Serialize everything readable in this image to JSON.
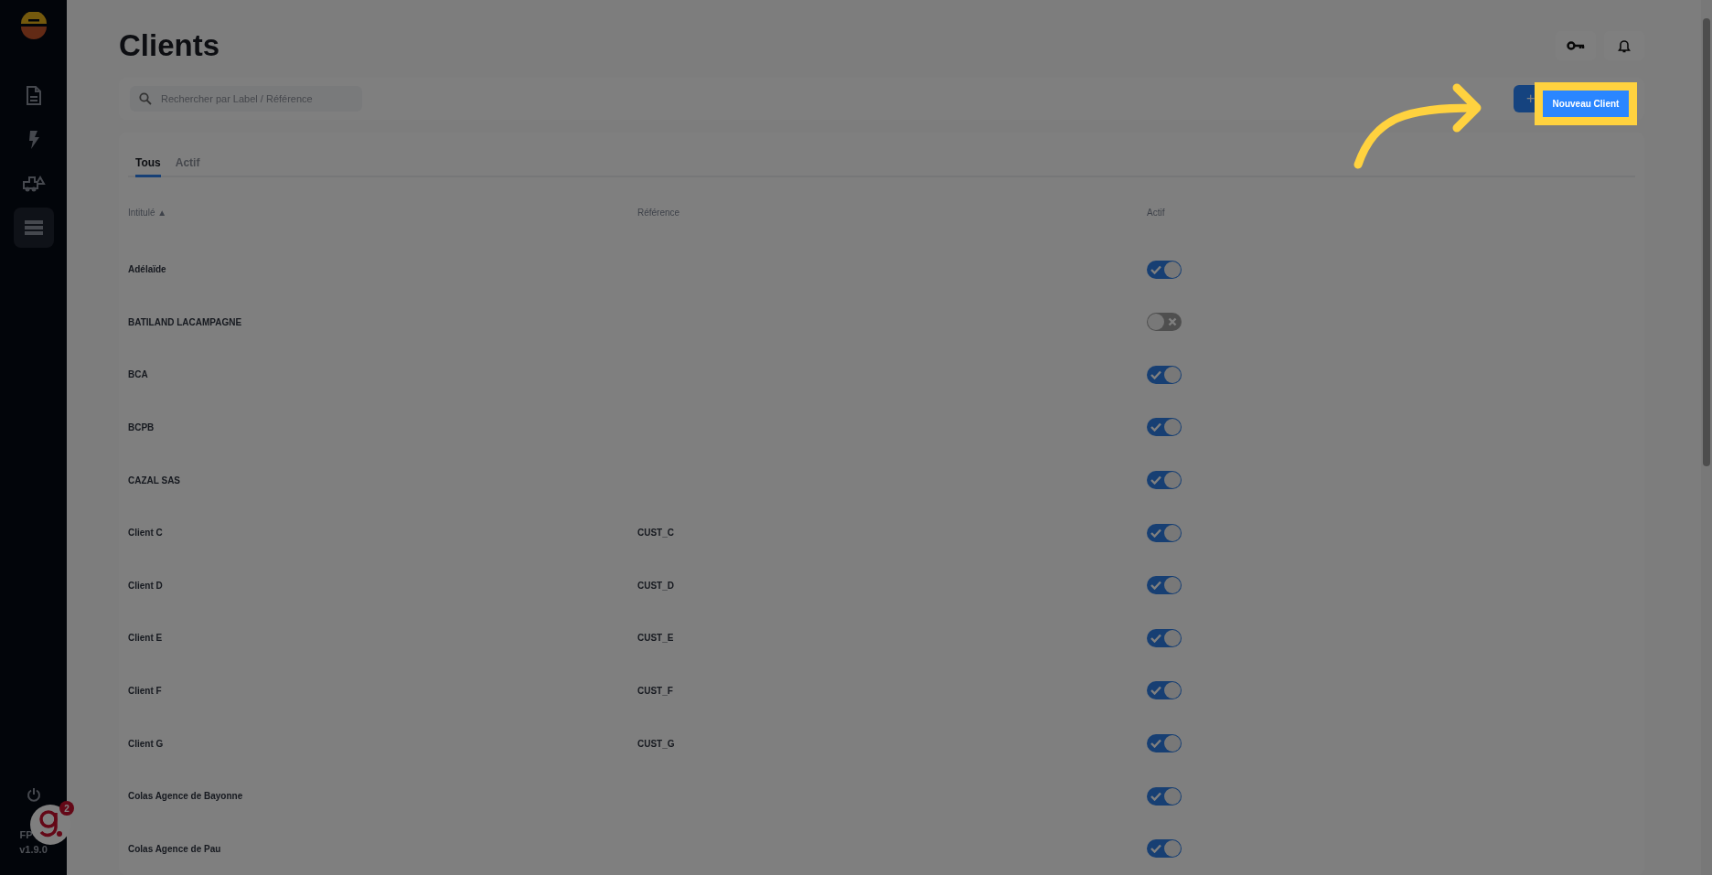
{
  "sidebar": {
    "items": [
      {
        "kind": "document",
        "selected": false
      },
      {
        "kind": "bolt",
        "selected": false
      },
      {
        "kind": "truck",
        "selected": false
      },
      {
        "kind": "list",
        "selected": true
      }
    ],
    "footer_label": "FP",
    "version": "v1.9.0",
    "badge_count": "2"
  },
  "page": {
    "title": "Clients"
  },
  "search": {
    "placeholder": "Rechercher par Label / Référence"
  },
  "new_button": {
    "icon_text": "+",
    "label": "Nouveau Client"
  },
  "tabs": [
    {
      "label": "Tous",
      "selected": true
    },
    {
      "label": "Actif",
      "selected": false
    }
  ],
  "table": {
    "columns": [
      "Intitulé ▲",
      "Référence",
      "Actif"
    ],
    "rows": [
      {
        "name": "Adélaïde",
        "reference": "",
        "active": true
      },
      {
        "name": "BATILAND LACAMPAGNE",
        "reference": "",
        "active": false
      },
      {
        "name": "BCA",
        "reference": "",
        "active": true
      },
      {
        "name": "BCPB",
        "reference": "",
        "active": true
      },
      {
        "name": "CAZAL SAS",
        "reference": "",
        "active": true
      },
      {
        "name": "Client C",
        "reference": "CUST_C",
        "active": true
      },
      {
        "name": "Client D",
        "reference": "CUST_D",
        "active": true
      },
      {
        "name": "Client E",
        "reference": "CUST_E",
        "active": true
      },
      {
        "name": "Client F",
        "reference": "CUST_F",
        "active": true
      },
      {
        "name": "Client G",
        "reference": "CUST_G",
        "active": true
      },
      {
        "name": "Colas Agence de Bayonne",
        "reference": "",
        "active": true
      },
      {
        "name": "Colas Agence de Pau",
        "reference": "",
        "active": true
      }
    ]
  }
}
